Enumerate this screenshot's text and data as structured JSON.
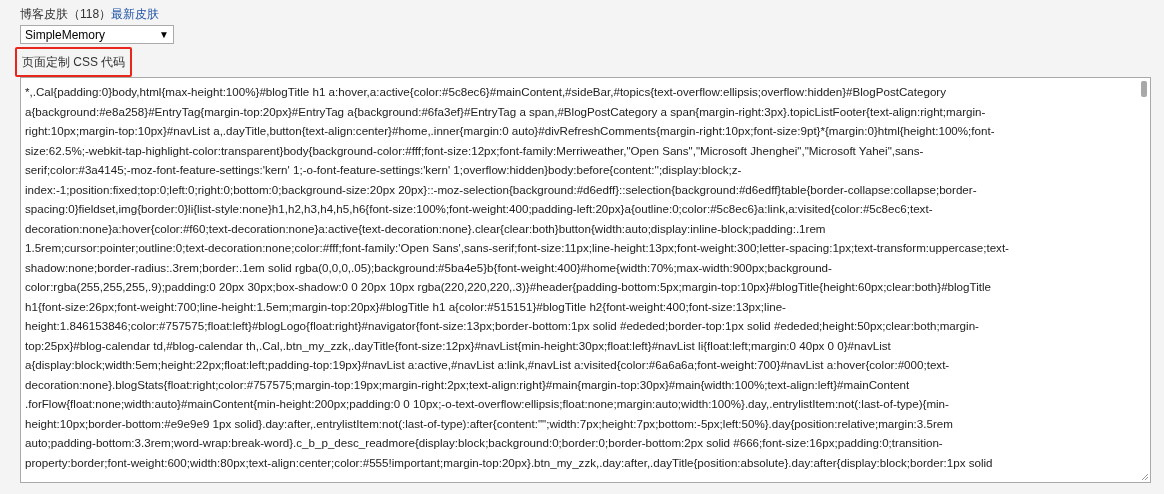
{
  "skin": {
    "label": "博客皮肤（118）",
    "link": "最新皮肤",
    "select_value": "SimpleMemory",
    "select_arrow": "▼"
  },
  "css_section": {
    "label": "页面定制 CSS 代码",
    "highlighted": true,
    "lines": [
      "*,.Cal{padding:0}body,html{max-height:100%}#blogTitle h1 a:hover,a:active{color:#5c8ec6}#mainContent,#sideBar,#topics{text-overflow:ellipsis;overflow:hidden}#BlogPostCategory",
      "a{background:#e8a258}#EntryTag{margin-top:20px}#EntryTag a{background:#6fa3ef}#EntryTag a span,#BlogPostCategory a span{margin-right:3px}.topicListFooter{text-align:right;margin-",
      "right:10px;margin-top:10px}#navList a,.dayTitle,button{text-align:center}#home,.inner{margin:0 auto}#divRefreshComments{margin-right:10px;font-size:9pt}*{margin:0}html{height:100%;font-",
      "size:62.5%;-webkit-tap-highlight-color:transparent}body{background-color:#fff;font-size:12px;font-family:Merriweather,\"Open Sans\",\"Microsoft Jhenghei\",\"Microsoft Yahei\",sans-",
      "serif;color:#3a4145;-moz-font-feature-settings:'kern' 1;-o-font-feature-settings:'kern' 1;overflow:hidden}body:before{content:'';display:block;z-",
      "index:-1;position:fixed;top:0;left:0;right:0;bottom:0;background-size:20px 20px}::-moz-selection{background:#d6edff}::selection{background:#d6edff}table{border-collapse:collapse;border-",
      "spacing:0}fieldset,img{border:0}li{list-style:none}h1,h2,h3,h4,h5,h6{font-size:100%;font-weight:400;padding-left:20px}a{outline:0;color:#5c8ec6}a:link,a:visited{color:#5c8ec6;text-",
      "decoration:none}a:hover{color:#f60;text-decoration:none}a:active{text-decoration:none}.clear{clear:both}button{width:auto;display:inline-block;padding:.1rem",
      "1.5rem;cursor:pointer;outline:0;text-decoration:none;color:#fff;font-family:'Open Sans',sans-serif;font-size:11px;line-height:13px;font-weight:300;letter-spacing:1px;text-transform:uppercase;text-",
      "shadow:none;border-radius:.3rem;border:.1em solid rgba(0,0,0,.05);background:#5ba4e5}b{font-weight:400}#home{width:70%;max-width:900px;background-",
      "color:rgba(255,255,255,.9);padding:0 20px 30px;box-shadow:0 0 20px 10px rgba(220,220,220,.3)}#header{padding-bottom:5px;margin-top:10px}#blogTitle{height:60px;clear:both}#blogTitle",
      "h1{font-size:26px;font-weight:700;line-height:1.5em;margin-top:20px}#blogTitle h1 a{color:#515151}#blogTitle h2{font-weight:400;font-size:13px;line-",
      "height:1.846153846;color:#757575;float:left}#blogLogo{float:right}#navigator{font-size:13px;border-bottom:1px solid #ededed;border-top:1px solid #ededed;height:50px;clear:both;margin-",
      "top:25px}#blog-calendar td,#blog-calendar th,.Cal,.btn_my_zzk,.dayTitle{font-size:12px}#navList{min-height:30px;float:left}#navList li{float:left;margin:0 40px 0 0}#navList",
      "a{display:block;width:5em;height:22px;float:left;padding-top:19px}#navList a:active,#navList a:link,#navList a:visited{color:#6a6a6a;font-weight:700}#navList a:hover{color:#000;text-",
      "decoration:none}.blogStats{float:right;color:#757575;margin-top:19px;margin-right:2px;text-align:right}#main{margin-top:30px}#main{width:100%;text-align:left}#mainContent",
      ".forFlow{float:none;width:auto}#mainContent{min-height:200px;padding:0 0 10px;-o-text-overflow:ellipsis;float:none;margin:auto;width:100%}.day,.entrylistItem:not(:last-of-type){min-",
      "height:10px;border-bottom:#e9e9e9 1px solid}.day:after,.entrylistItem:not(:last-of-type):after{content:\"\";width:7px;height:7px;bottom:-5px;left:50%}.day{position:relative;margin:3.5rem",
      "auto;padding-bottom:3.3rem;word-wrap:break-word}.c_b_p_desc_readmore{display:block;background:0;border:0;border-bottom:2px solid #666;font-size:16px;padding:0;transition-",
      "property:border;font-weight:600;width:80px;text-align:center;color:#555!important;margin-top:20px}.btn_my_zzk,.day:after,.dayTitle{position:absolute}.day:after{display:block;border:1px solid"
    ]
  }
}
